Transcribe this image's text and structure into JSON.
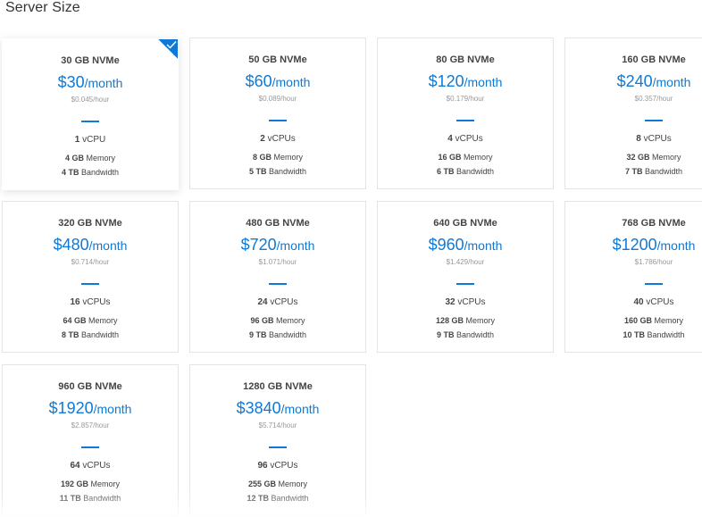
{
  "heading": "Server Size",
  "colors": {
    "accent": "#0e79d6",
    "border": "#e4e4e4"
  },
  "selected_index": 0,
  "plans": [
    {
      "title": "30 GB NVMe",
      "price": "$30",
      "per": "/month",
      "hourly": "$0.045/hour",
      "cpu_num": "1",
      "cpu_label": "vCPU",
      "mem_num": "4 GB",
      "mem_label": "Memory",
      "bw_num": "4 TB",
      "bw_label": "Bandwidth"
    },
    {
      "title": "50 GB NVMe",
      "price": "$60",
      "per": "/month",
      "hourly": "$0.089/hour",
      "cpu_num": "2",
      "cpu_label": "vCPUs",
      "mem_num": "8 GB",
      "mem_label": "Memory",
      "bw_num": "5 TB",
      "bw_label": "Bandwidth"
    },
    {
      "title": "80 GB NVMe",
      "price": "$120",
      "per": "/month",
      "hourly": "$0.179/hour",
      "cpu_num": "4",
      "cpu_label": "vCPUs",
      "mem_num": "16 GB",
      "mem_label": "Memory",
      "bw_num": "6 TB",
      "bw_label": "Bandwidth"
    },
    {
      "title": "160 GB NVMe",
      "price": "$240",
      "per": "/month",
      "hourly": "$0.357/hour",
      "cpu_num": "8",
      "cpu_label": "vCPUs",
      "mem_num": "32 GB",
      "mem_label": "Memory",
      "bw_num": "7 TB",
      "bw_label": "Bandwidth"
    },
    {
      "title": "320 GB NVMe",
      "price": "$480",
      "per": "/month",
      "hourly": "$0.714/hour",
      "cpu_num": "16",
      "cpu_label": "vCPUs",
      "mem_num": "64 GB",
      "mem_label": "Memory",
      "bw_num": "8 TB",
      "bw_label": "Bandwidth"
    },
    {
      "title": "480 GB NVMe",
      "price": "$720",
      "per": "/month",
      "hourly": "$1.071/hour",
      "cpu_num": "24",
      "cpu_label": "vCPUs",
      "mem_num": "96 GB",
      "mem_label": "Memory",
      "bw_num": "9 TB",
      "bw_label": "Bandwidth"
    },
    {
      "title": "640 GB NVMe",
      "price": "$960",
      "per": "/month",
      "hourly": "$1.429/hour",
      "cpu_num": "32",
      "cpu_label": "vCPUs",
      "mem_num": "128 GB",
      "mem_label": "Memory",
      "bw_num": "9 TB",
      "bw_label": "Bandwidth"
    },
    {
      "title": "768 GB NVMe",
      "price": "$1200",
      "per": "/month",
      "hourly": "$1.786/hour",
      "cpu_num": "40",
      "cpu_label": "vCPUs",
      "mem_num": "160 GB",
      "mem_label": "Memory",
      "bw_num": "10 TB",
      "bw_label": "Bandwidth"
    },
    {
      "title": "960 GB NVMe",
      "price": "$1920",
      "per": "/month",
      "hourly": "$2.857/hour",
      "cpu_num": "64",
      "cpu_label": "vCPUs",
      "mem_num": "192 GB",
      "mem_label": "Memory",
      "bw_num": "11 TB",
      "bw_label": "Bandwidth"
    },
    {
      "title": "1280 GB NVMe",
      "price": "$3840",
      "per": "/month",
      "hourly": "$5.714/hour",
      "cpu_num": "96",
      "cpu_label": "vCPUs",
      "mem_num": "255 GB",
      "mem_label": "Memory",
      "bw_num": "12 TB",
      "bw_label": "Bandwidth"
    }
  ]
}
